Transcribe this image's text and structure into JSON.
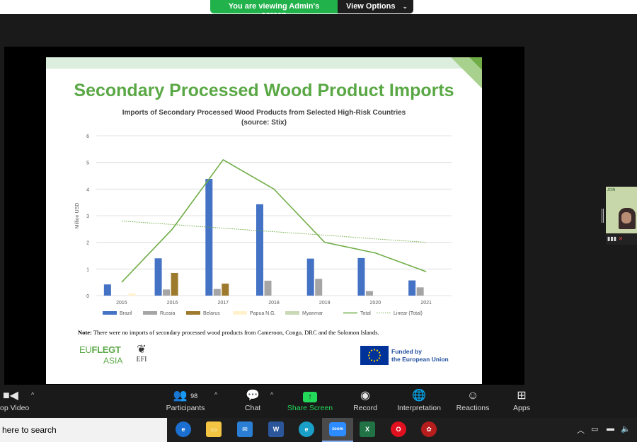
{
  "banner": {
    "viewing_text": "You are viewing Admin's screen",
    "view_options_label": "View Options",
    "view_options_chevron": "chevron-down-icon"
  },
  "slide": {
    "title": "Secondary Processed Wood Product Imports",
    "chart_title_line1": "Imports of Secondary Processed Wood Products from Selected High-Risk Countries",
    "chart_title_line2": "(source: Stix)",
    "note_label": "Note:",
    "note_text": " There were no imports of secondary processed wood products from Cameroon, Congo, DRC and the Solomon Islands.",
    "logo_line1a": "EU",
    "logo_line1b": "FLEGT",
    "logo_line2": "ASIA",
    "efi_text": "EFI",
    "eu_line1": "Funded by",
    "eu_line2": "the European Union"
  },
  "chart_data": {
    "type": "bar",
    "title": "Imports of Secondary Processed Wood Products from Selected High-Risk Countries (source: Stix)",
    "ylabel": "Million USD",
    "xlabel": "",
    "ylim": [
      0,
      6
    ],
    "yticks": [
      "0",
      "1",
      "2",
      "3",
      "4",
      "5",
      "6"
    ],
    "categories": [
      "2015",
      "2016",
      "2017",
      "2018",
      "2019",
      "2020",
      "2021"
    ],
    "series": [
      {
        "name": "Brazil",
        "type": "bar",
        "color": "#4472c4",
        "values": [
          0.42,
          1.4,
          4.38,
          3.43,
          1.39,
          1.41,
          0.57
        ]
      },
      {
        "name": "Russia",
        "type": "bar",
        "color": "#a5a5a5",
        "values": [
          0,
          0.23,
          0.25,
          0.56,
          0.63,
          0.17,
          0.31
        ]
      },
      {
        "name": "Belarus",
        "type": "bar",
        "color": "#9e7a2e",
        "values": [
          0,
          0.85,
          0.45,
          0,
          0,
          0,
          0
        ]
      },
      {
        "name": "Papua N.G.",
        "type": "bar",
        "color": "#fff2cc",
        "values": [
          0.08,
          0,
          0,
          0,
          0,
          0,
          0
        ]
      },
      {
        "name": "Myanmar",
        "type": "bar",
        "color": "#c9d9b6",
        "values": [
          0,
          0,
          0,
          0,
          0,
          0,
          0
        ]
      },
      {
        "name": "Total",
        "type": "line",
        "color": "#70ad47",
        "values": [
          0.5,
          2.5,
          5.1,
          4.0,
          2.0,
          1.6,
          0.9
        ]
      },
      {
        "name": "Linear (Total)",
        "type": "trendline",
        "color": "#70ad47",
        "values": [
          2.8,
          2.67,
          2.53,
          2.4,
          2.27,
          2.13,
          2.0
        ]
      }
    ],
    "grid": true,
    "legend_position": "bottom"
  },
  "participant_tile": {
    "tile_text": "JOIN"
  },
  "toolbar": {
    "video_label": "op Video",
    "participants_label": "Participants",
    "participants_count": "98",
    "chat_label": "Chat",
    "share_label": "Share Screen",
    "record_label": "Record",
    "interpretation_label": "Interpretation",
    "reactions_label": "Reactions",
    "apps_label": "Apps"
  },
  "taskbar": {
    "search_placeholder": "here to search",
    "zoom_label": "zoom",
    "apps": [
      "edge-icon",
      "file-explorer-icon",
      "mail-icon",
      "word-icon",
      "edge-browser-icon",
      "zoom-icon",
      "excel-icon",
      "opera-icon",
      "game-icon"
    ],
    "colors": {
      "accent": "#23d959",
      "slide_green": "#5aa845",
      "eu_blue": "#003399"
    }
  }
}
